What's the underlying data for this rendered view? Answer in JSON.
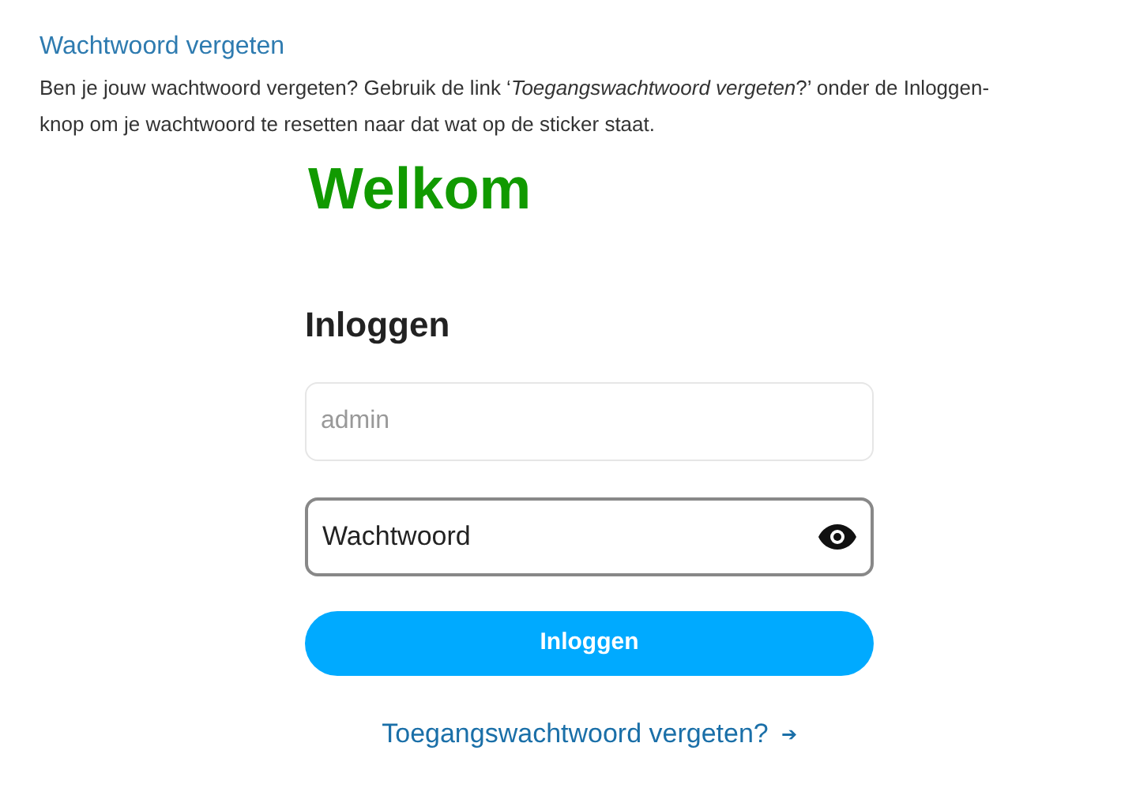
{
  "article": {
    "title": "Wachtwoord vergeten",
    "paragraph": "Ben je jouw wachtwoord vergeten? Gebruik de link ‘*Toegangswachtwoord vergeten*?’ onder de Inloggen-knop om je wachtwoord te resetten naar dat wat op de sticker staat."
  },
  "login": {
    "welcome": "Welkom",
    "heading": "Inloggen",
    "username": {
      "placeholder": "admin"
    },
    "password": {
      "value": "Wachtwoord",
      "focused": true
    },
    "submit": "Inloggen",
    "forgot_link": {
      "label": "Toegangswachtwoord vergeten?",
      "arrow": "➔"
    }
  }
}
